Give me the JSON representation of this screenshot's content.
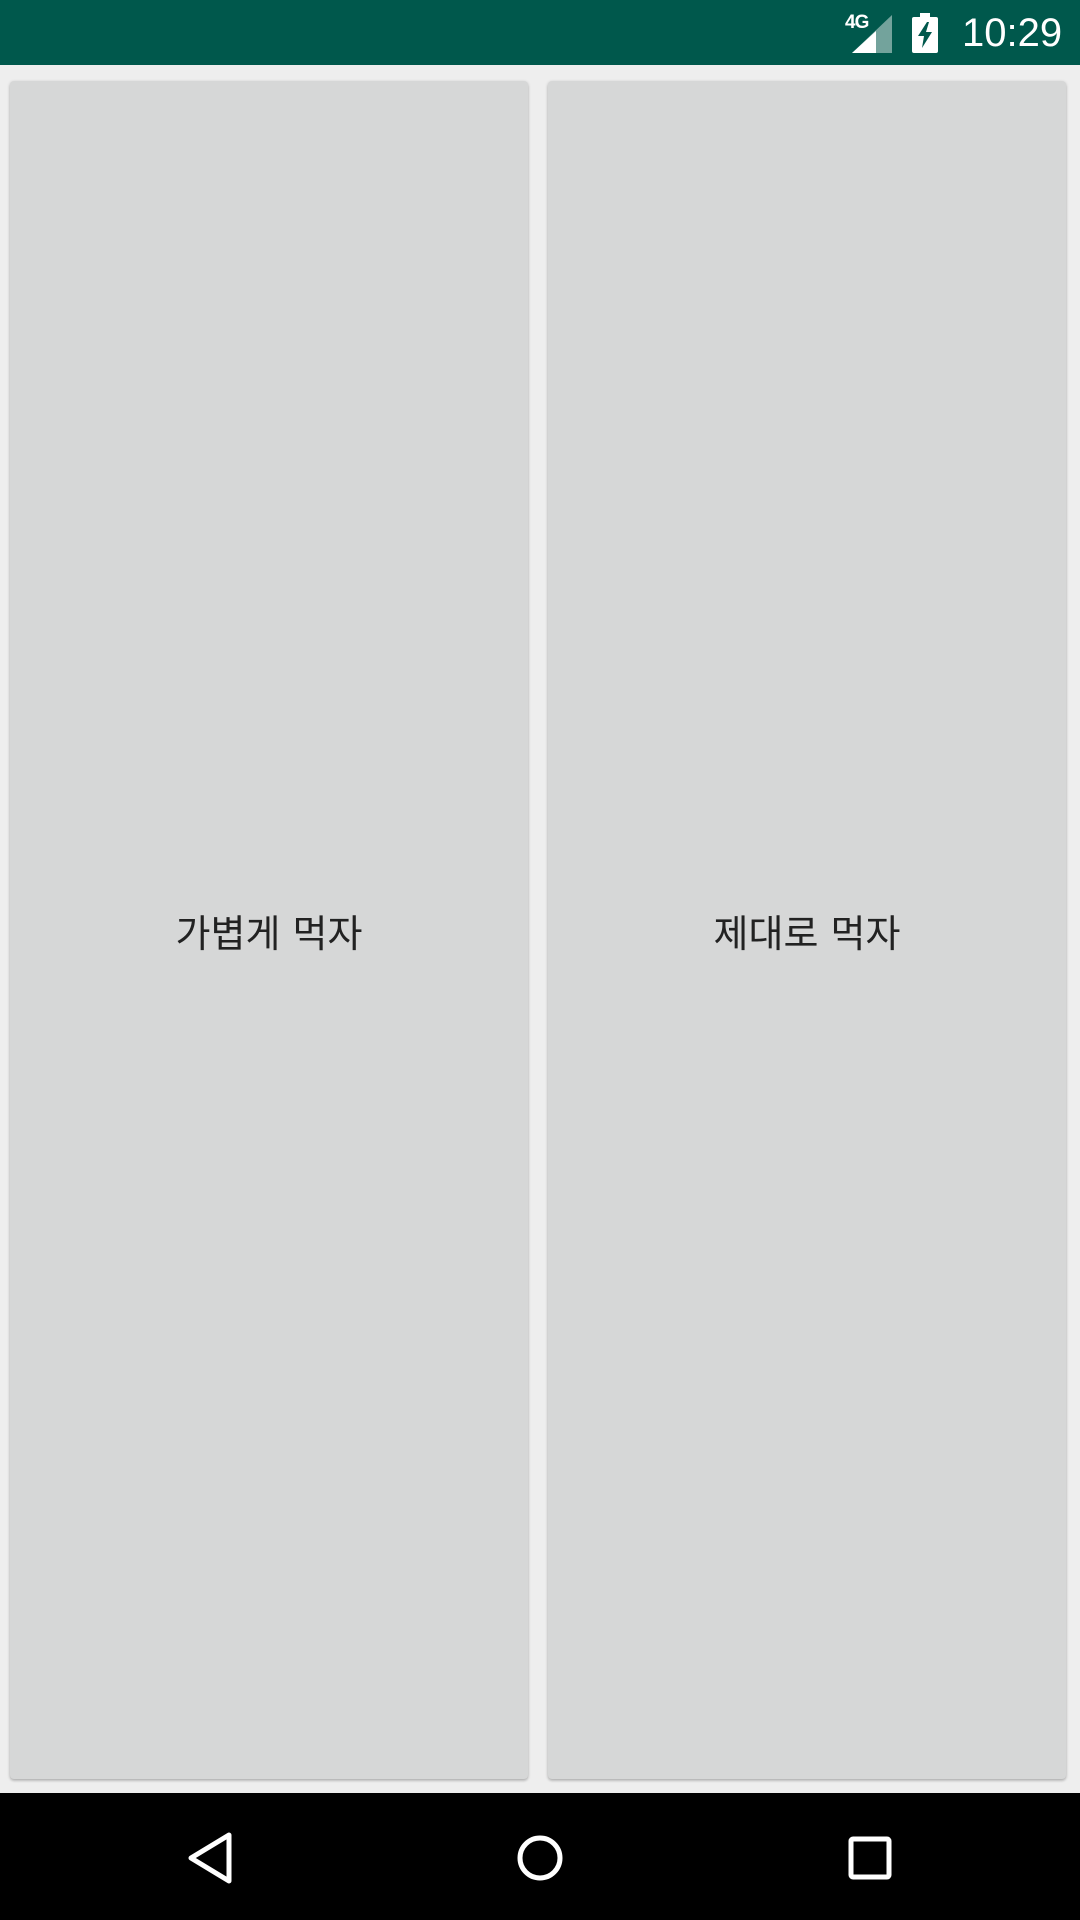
{
  "status_bar": {
    "network_type": "4G",
    "clock": "10:29",
    "background_color": "#00584c",
    "icons": [
      "signal-icon",
      "battery-charging-icon"
    ]
  },
  "main": {
    "buttons": [
      {
        "label": "가볍게 먹자"
      },
      {
        "label": "제대로 먹자"
      }
    ],
    "button_color": "#d6d7d7",
    "background_color": "#eeeeee"
  },
  "nav_bar": {
    "icons": [
      "back-icon",
      "home-icon",
      "recents-icon"
    ]
  }
}
